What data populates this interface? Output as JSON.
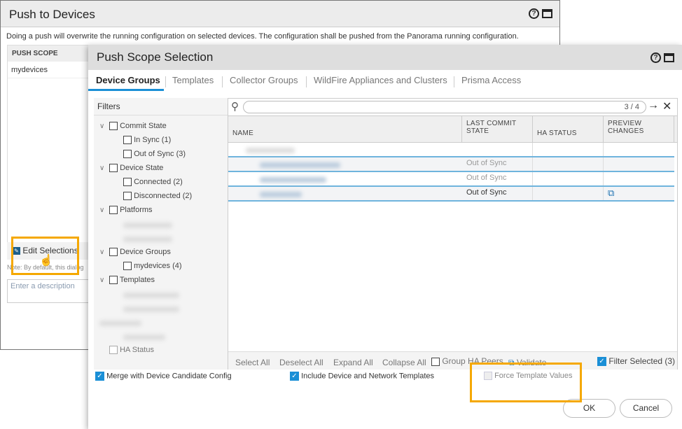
{
  "background_dialog": {
    "title": "Push to Devices",
    "description": "Doing a push will overwrite the running configuration on selected devices. The configuration shall be pushed from the Panorama running configuration.",
    "push_scope_header": "PUSH SCOPE",
    "push_scope_value": "mydevices",
    "edit_selections": "Edit Selections",
    "note": "Note: By default, this dialog",
    "description_placeholder": "Enter a description"
  },
  "dialog": {
    "title": "Push Scope Selection",
    "tabs": [
      {
        "label": "Device Groups"
      },
      {
        "label": "Templates"
      },
      {
        "label": "Collector Groups"
      },
      {
        "label": "WildFire Appliances and Clusters"
      },
      {
        "label": "Prisma Access"
      }
    ],
    "filters": {
      "title": "Filters",
      "items": [
        "Commit State",
        "In Sync (1)",
        "Out of Sync (3)",
        "Device State",
        "Connected (2)",
        "Disconnected (2)",
        "Platforms",
        "Device Groups",
        "mydevices (4)",
        "Templates",
        "HA Status"
      ]
    },
    "search": {
      "counter": "3 / 4"
    },
    "columns": [
      "NAME",
      "LAST COMMIT STATE",
      "HA STATUS",
      "PREVIEW CHANGES"
    ],
    "rows": [
      {
        "state": ""
      },
      {
        "state": "Out of Sync"
      },
      {
        "state": "Out of Sync"
      },
      {
        "state": "Out of Sync"
      }
    ],
    "toolbar": {
      "select_all": "Select All",
      "deselect_all": "Deselect All",
      "expand_all": "Expand All",
      "collapse_all": "Collapse All",
      "group_ha": "Group HA Peers",
      "validate": "Validate",
      "filter_selected": "Filter Selected (3)"
    },
    "options": {
      "merge": "Merge with Device Candidate Config",
      "include": "Include Device and Network Templates",
      "force": "Force Template Values"
    },
    "ok": "OK",
    "cancel": "Cancel"
  },
  "colors": {
    "accent": "#1a8fd6",
    "highlight": "#f5a800"
  }
}
